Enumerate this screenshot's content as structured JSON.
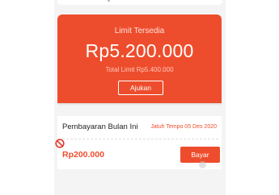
{
  "limit_card": {
    "title": "Limit Tersedia",
    "amount": "Rp5.200.000",
    "total_limit": "Total Limit Rp5.400.000",
    "apply_button_label": "Ajukan"
  },
  "monthly_payment": {
    "title": "Pembayaran Bulan Ini",
    "due_date": "Jatuh Tempo 05 Des 2020",
    "amount": "Rp200.000",
    "pay_button_label": "Bayar"
  },
  "icons": {
    "badge": "prohibited-icon",
    "touch": "touch-indicator"
  },
  "colors": {
    "accent": "#ee4d2d",
    "background": "#f4f4f4"
  }
}
